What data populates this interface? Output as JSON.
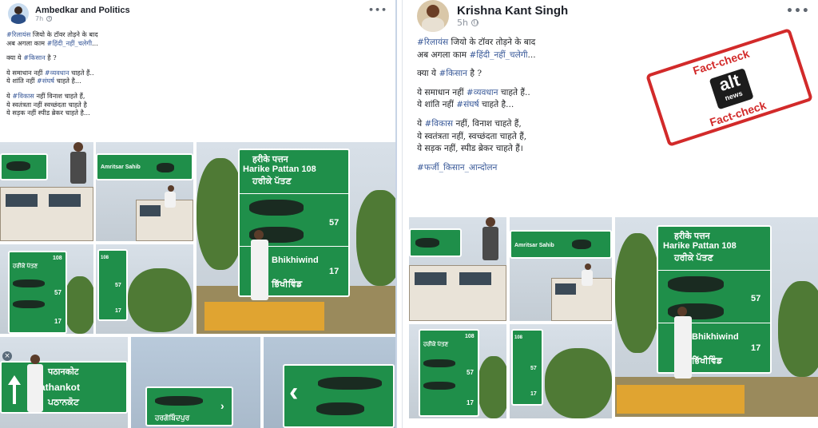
{
  "left_post": {
    "author": "Ambedkar and Politics",
    "time": "7h",
    "more_icon": "•••",
    "text_lines": [
      [
        {
          "t": "#रिलायंस",
          "tag": true
        },
        {
          "t": " जियो के टॉवर तोड़ने के बाद"
        }
      ],
      [
        {
          "t": "अब अगला काम "
        },
        {
          "t": "#हिंदी_नहीं_चलेगी",
          "tag": true
        },
        {
          "t": "..."
        }
      ],
      [],
      [
        {
          "t": "क्या ये "
        },
        {
          "t": "#किसान",
          "tag": true
        },
        {
          "t": " है ?"
        }
      ],
      [],
      [
        {
          "t": "ये समाधान नहीं "
        },
        {
          "t": "#व्यवधान",
          "tag": true
        },
        {
          "t": " चाहते हैं.."
        }
      ],
      [
        {
          "t": "ये शांति नहीं "
        },
        {
          "t": "#संघर्ष",
          "tag": true
        },
        {
          "t": " चाहते है..."
        }
      ],
      [],
      [
        {
          "t": "ये "
        },
        {
          "t": "#विकास",
          "tag": true
        },
        {
          "t": " नहीं विनाश चाहते हैं,"
        }
      ],
      [
        {
          "t": "ये स्वतंत्रता नहीं स्वच्छंदता चाहते है"
        }
      ],
      [
        {
          "t": "ये सड़क नहीं स्पीड ब्रेकर चाहते है..."
        }
      ]
    ],
    "signs": {
      "harike_hindi": "हरीके पत्तन",
      "harike_english": "Harike Pattan 108",
      "harike_punjabi": "ਹਰੀਕੇ ਪੱਤਣ",
      "dist_57": "57",
      "dist_17": "17",
      "bh_english": "Bhikhiwind",
      "bh_punjabi": "ਭਿੱਖੀਵਿੰਡ",
      "amritsar": "Amritsar Sahib",
      "pathankot_hindi": "पठानकोट",
      "pathankot_english": "Pathankot",
      "pathankot_punjabi": "ਪਠਾਨਕੋਟ",
      "hargobindpur": "ਹਰਗੋਬਿੰਦਪੁਰ",
      "small_108": "108"
    }
  },
  "right_post": {
    "author": "Krishna Kant Singh",
    "time": "5h",
    "more_icon": "•••",
    "text_lines": [
      [
        {
          "t": "#रिलायंस",
          "tag": true
        },
        {
          "t": " जियो के टॉवर तोड़ने के बाद"
        }
      ],
      [
        {
          "t": "अब अगला काम "
        },
        {
          "t": "#हिंदी_नहीं_चलेगी",
          "tag": true
        },
        {
          "t": "..."
        }
      ],
      [],
      [
        {
          "t": "क्या ये "
        },
        {
          "t": "#किसान",
          "tag": true
        },
        {
          "t": " है ?"
        }
      ],
      [],
      [
        {
          "t": "ये समाधान नहीं "
        },
        {
          "t": "#व्यवधान",
          "tag": true
        },
        {
          "t": " चाहते हैं.."
        }
      ],
      [
        {
          "t": "ये शांति नहीं "
        },
        {
          "t": "#संघर्ष",
          "tag": true
        },
        {
          "t": " चाहते है..."
        }
      ],
      [],
      [
        {
          "t": "ये "
        },
        {
          "t": "#विकास",
          "tag": true
        },
        {
          "t": " नहीं, विनाश चाहते हैं,"
        }
      ],
      [
        {
          "t": "ये स्वतंत्रता नहीं, स्वच्छंदता चाहते हैं,"
        }
      ],
      [
        {
          "t": "ये सड़क नहीं, स्पीड ब्रेकर चाहते हैं।"
        }
      ],
      [],
      [
        {
          "t": "#फर्जी_किसान_आन्दोलन",
          "tag": true
        }
      ]
    ],
    "signs": {
      "harike_hindi": "हरीके पत्तन",
      "harike_english": "Harike Pattan 108",
      "harike_punjabi": "ਹਰੀਕੇ ਪੱਤਣ",
      "dist_57": "57",
      "dist_17": "17",
      "bh_english": "Bhikhiwind",
      "bh_punjabi": "ਭਿੱਖੀਵਿੰਡ",
      "amritsar": "Amritsar Sahib",
      "small_108": "108"
    }
  },
  "stamp": {
    "top": "Fact-check",
    "bottom": "Fact-check",
    "brand_1": "alt",
    "brand_2": "news"
  },
  "colors": {
    "sign_green": "#1f8f4a",
    "hashtag_blue": "#385898",
    "stamp_red": "#d22a2a"
  }
}
